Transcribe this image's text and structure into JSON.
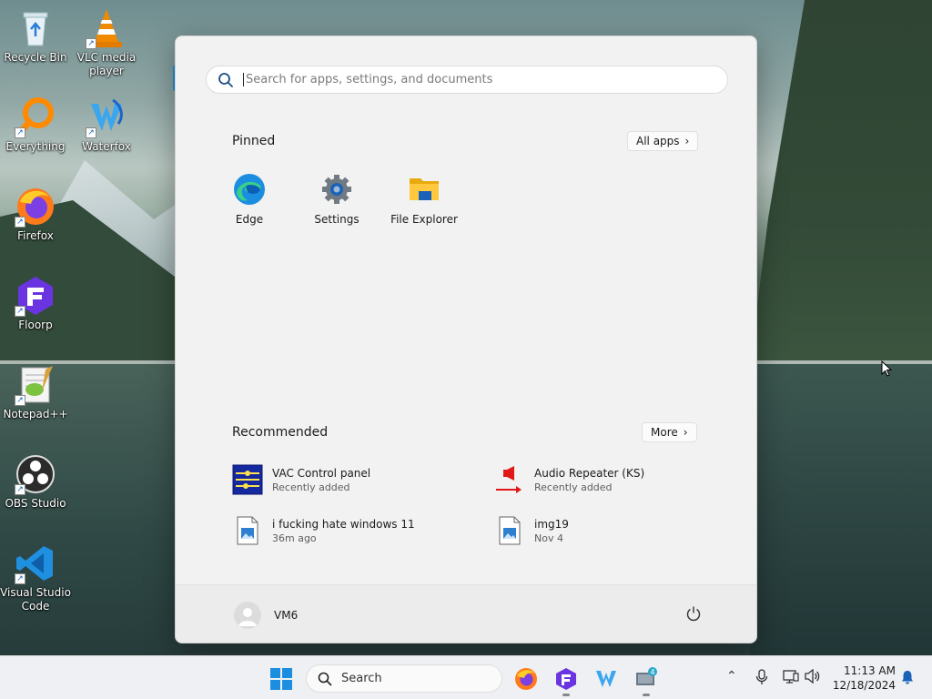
{
  "desktop": {
    "icons": [
      {
        "label": "Recycle Bin",
        "icon": "recycle-bin-icon"
      },
      {
        "label": "VLC media player",
        "icon": "vlc-icon"
      },
      {
        "label": "Everything",
        "icon": "everything-icon"
      },
      {
        "label": "Waterfox",
        "icon": "waterfox-icon"
      },
      {
        "label": "Firefox",
        "icon": "firefox-icon"
      },
      {
        "label": "Floorp",
        "icon": "floorp-icon"
      },
      {
        "label": "Notepad++",
        "icon": "notepadpp-icon"
      },
      {
        "label": "OBS Studio",
        "icon": "obs-icon"
      },
      {
        "label": "Visual Studio Code",
        "icon": "vscode-icon"
      }
    ]
  },
  "start_menu": {
    "search_placeholder": "Search for apps, settings, and documents",
    "pinned_title": "Pinned",
    "all_apps_label": "All apps",
    "pinned": [
      {
        "label": "Edge",
        "icon": "edge-icon"
      },
      {
        "label": "Settings",
        "icon": "settings-gear-icon"
      },
      {
        "label": "File Explorer",
        "icon": "folder-icon"
      }
    ],
    "recommended_title": "Recommended",
    "more_label": "More",
    "recommended": [
      {
        "title": "VAC Control panel",
        "subtitle": "Recently added",
        "icon": "vac-icon"
      },
      {
        "title": "Audio Repeater (KS)",
        "subtitle": "Recently added",
        "icon": "speaker-icon"
      },
      {
        "title": "i fucking hate windows 11",
        "subtitle": "36m ago",
        "icon": "image-file-icon"
      },
      {
        "title": "img19",
        "subtitle": "Nov 4",
        "icon": "image-file-icon"
      }
    ],
    "user_name": "VM6"
  },
  "taskbar": {
    "search_label": "Search",
    "time": "11:13 AM",
    "date": "12/18/2024",
    "badge_count": "4"
  },
  "colors": {
    "accent": "#1e90d8",
    "menu_bg": "#f2f2f2",
    "taskbar_bg": "#eef0f3"
  }
}
